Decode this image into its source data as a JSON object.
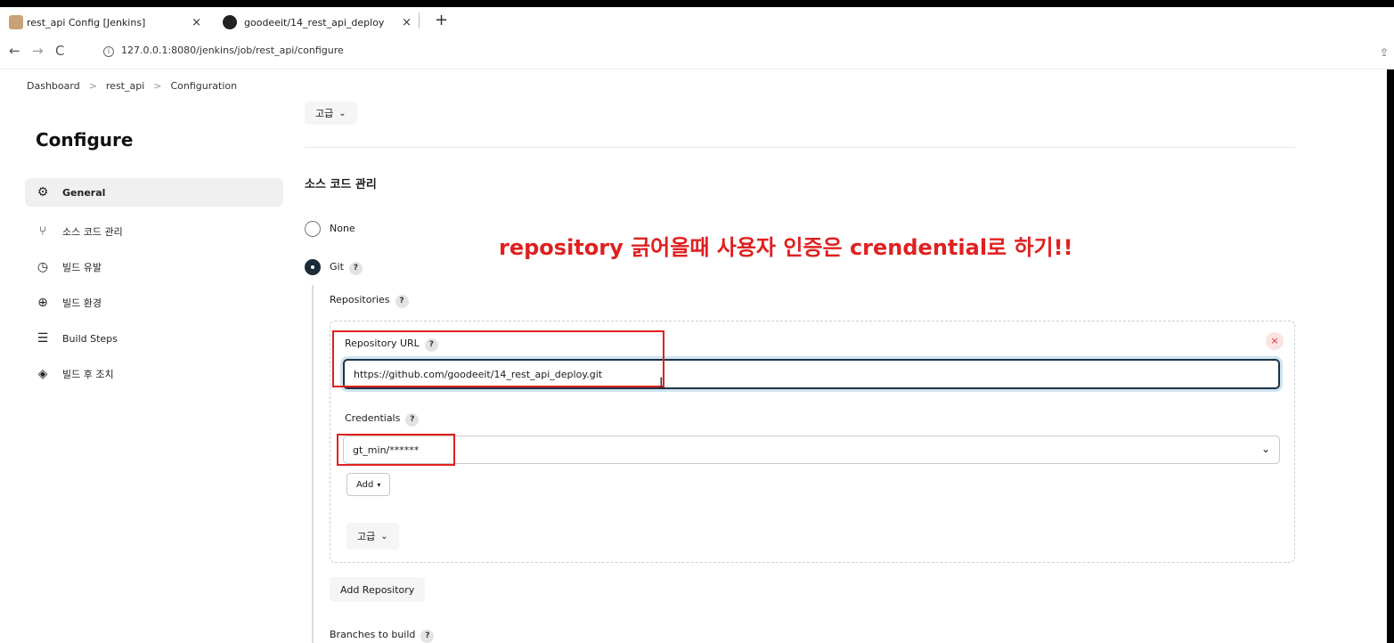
{
  "browser": {
    "tabs": [
      {
        "title": "rest_api Config [Jenkins]",
        "close": "×"
      },
      {
        "title": "goodeeit/14_rest_api_deploy",
        "close": "×"
      }
    ],
    "new_tab": "+",
    "url": "127.0.0.1:8080/jenkins/job/rest_api/configure"
  },
  "breadcrumb": [
    "Dashboard",
    "rest_api",
    "Configuration"
  ],
  "breadcrumb_sep": ">",
  "sidebar": {
    "title": "Configure",
    "items": [
      {
        "label": "General",
        "icon": "gear-icon"
      },
      {
        "label": "소스 코드 관리",
        "icon": "branch-icon"
      },
      {
        "label": "빌드 유발",
        "icon": "clock-icon"
      },
      {
        "label": "빌드 환경",
        "icon": "globe-icon"
      },
      {
        "label": "Build Steps",
        "icon": "list-icon"
      },
      {
        "label": "빌드 후 조치",
        "icon": "cube-icon"
      }
    ]
  },
  "main": {
    "advanced_label": "고급",
    "section_title": "소스 코드 관리",
    "scm_none": "None",
    "scm_git": "Git",
    "help": "?",
    "repositories_label": "Repositories",
    "repository_url_label": "Repository URL",
    "repository_url_value": "https://github.com/goodeeit/14_rest_api_deploy.git",
    "remove": "×",
    "credentials_label": "Credentials",
    "credentials_value": "gt_min/******",
    "add_label": "Add",
    "advanced_inner_label": "고급",
    "add_repository_label": "Add Repository",
    "branches_label": "Branches to build"
  },
  "annotation": {
    "text": "repository 긁어올때 사용자 인증은 crendential로 하기!!",
    "color": "#e02020"
  }
}
